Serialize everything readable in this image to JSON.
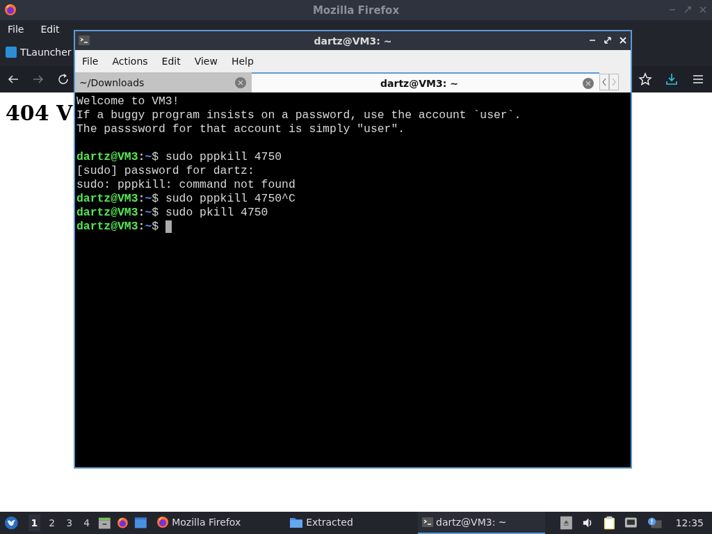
{
  "browser": {
    "title": "Mozilla Firefox",
    "menu": [
      "File",
      "Edit"
    ],
    "tabs": [
      {
        "label": "TLauncher",
        "selected": true
      }
    ],
    "page_heading": "404 V"
  },
  "terminal": {
    "title": "dartz@VM3: ~",
    "menu": [
      "File",
      "Actions",
      "Edit",
      "View",
      "Help"
    ],
    "tabs": [
      {
        "label": "~/Downloads",
        "selected": false
      },
      {
        "label": "dartz@VM3: ~",
        "selected": true
      }
    ],
    "lines": [
      {
        "kind": "output",
        "text": "Welcome to VM3!"
      },
      {
        "kind": "output",
        "text": "If a buggy program insists on a password, use the account `user`."
      },
      {
        "kind": "output",
        "text": "The passsword for that account is simply \"user\"."
      },
      {
        "kind": "blank"
      },
      {
        "kind": "prompt",
        "host": "dartz@VM3",
        "sep": ":",
        "path": "~",
        "symbol": "$",
        "text": "sudo pppkill 4750"
      },
      {
        "kind": "output",
        "text": "[sudo] password for dartz:"
      },
      {
        "kind": "output",
        "text": "sudo: pppkill: command not found"
      },
      {
        "kind": "prompt",
        "host": "dartz@VM3",
        "sep": ":",
        "path": "~",
        "symbol": "$",
        "text": "sudo pppkill 4750^C"
      },
      {
        "kind": "prompt",
        "host": "dartz@VM3",
        "sep": ":",
        "path": "~",
        "symbol": "$",
        "text": "sudo pkill 4750"
      },
      {
        "kind": "prompt",
        "host": "dartz@VM3",
        "sep": ":",
        "path": "~",
        "symbol": "$",
        "cursor": true
      }
    ]
  },
  "taskbar": {
    "workspaces": [
      {
        "label": "1",
        "selected": true
      },
      {
        "label": "2",
        "selected": false
      },
      {
        "label": "3",
        "selected": false
      },
      {
        "label": "4",
        "selected": false
      }
    ],
    "tasks": [
      {
        "label": "Mozilla Firefox",
        "kind": "firefox",
        "selected": false
      },
      {
        "label": "Extracted",
        "kind": "folder",
        "selected": false
      },
      {
        "label": "dartz@VM3: ~",
        "kind": "terminal",
        "selected": true
      }
    ],
    "clock": "12:35"
  }
}
